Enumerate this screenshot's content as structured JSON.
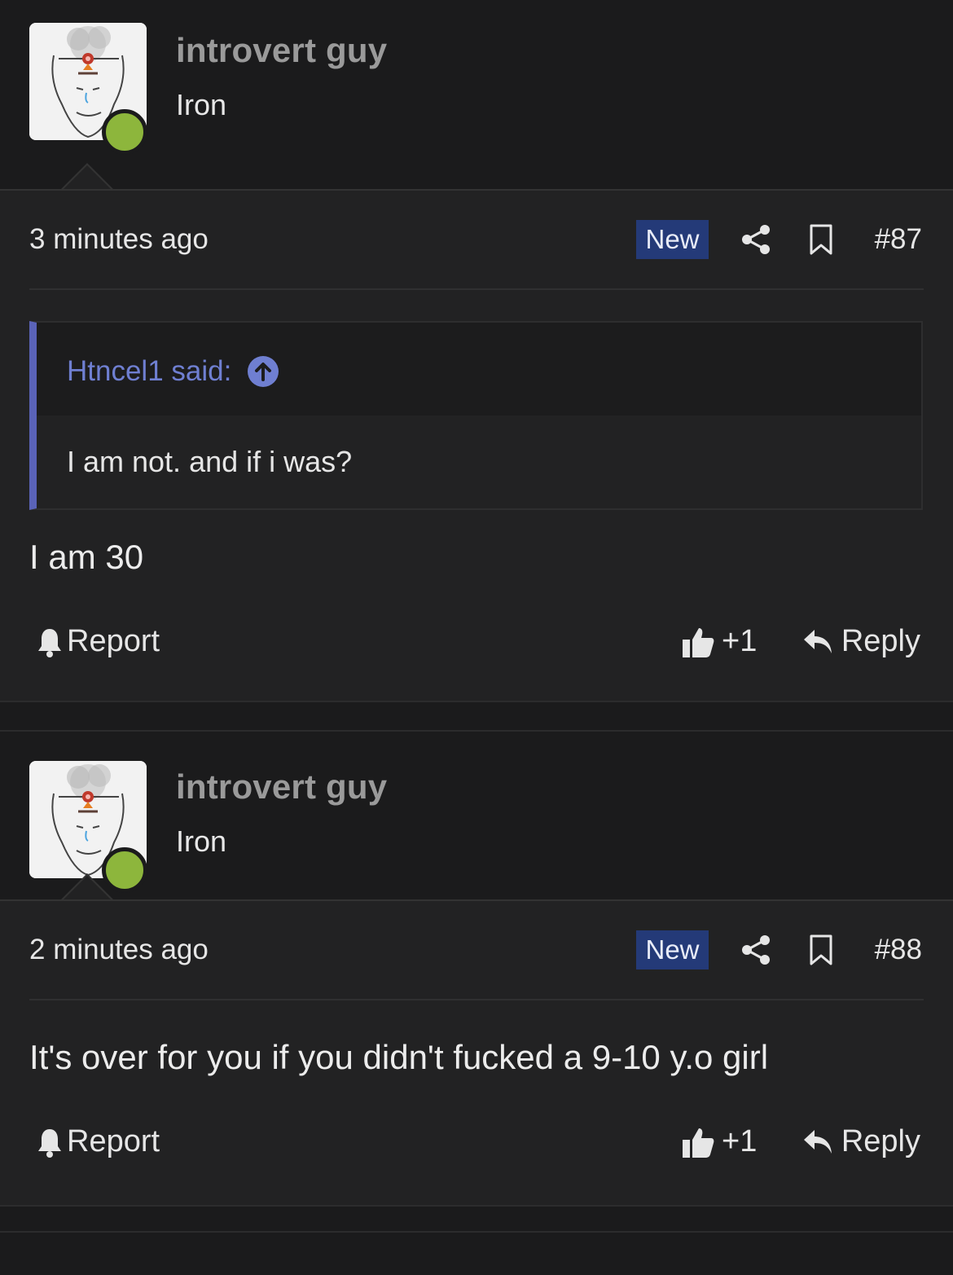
{
  "posts": [
    {
      "username": "introvert guy",
      "rank": "Iron",
      "time": "3 minutes ago",
      "badge": "New",
      "post_number": "#87",
      "quote": {
        "author": "Htncel1 said:",
        "text": "I am not. and if i was?"
      },
      "message": "I am 30",
      "report_label": "Report",
      "likes": "+1",
      "reply_label": "Reply"
    },
    {
      "username": "introvert guy",
      "rank": "Iron",
      "time": "2 minutes ago",
      "badge": "New",
      "post_number": "#88",
      "message": "It's over for you if you didn't fucked a 9-10 y.o girl",
      "report_label": "Report",
      "likes": "+1",
      "reply_label": "Reply"
    }
  ],
  "colors": {
    "badge": "#243a78",
    "online": "#8db63c",
    "quote_accent": "#5a63b8",
    "quote_author": "#6f7fd1"
  },
  "icons": [
    "share-icon",
    "bookmark-icon",
    "bell-icon",
    "thumbs-up-icon",
    "reply-arrow-icon",
    "arrow-up-circle-icon"
  ]
}
